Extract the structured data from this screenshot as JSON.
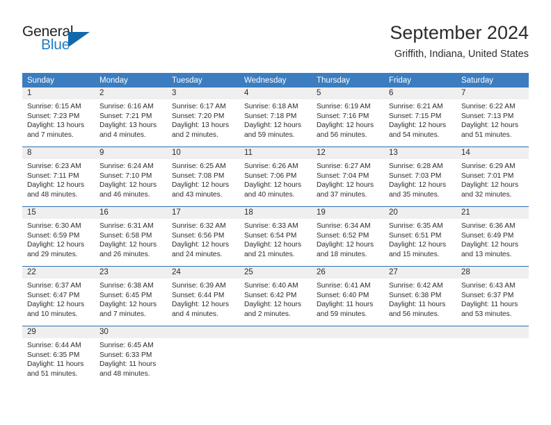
{
  "logo": {
    "word_top": "General",
    "word_bottom": "Blue",
    "triangle_color": "#1168ad",
    "blue_text_color": "#1f7fc4"
  },
  "header": {
    "title": "September 2024",
    "subtitle": "Griffith, Indiana, United States"
  },
  "theme": {
    "header_blue": "#3b7dbf",
    "separator_blue": "#2a6db5",
    "daynum_band": "#efefef",
    "text": "#2b2b2b"
  },
  "weekdays": [
    "Sunday",
    "Monday",
    "Tuesday",
    "Wednesday",
    "Thursday",
    "Friday",
    "Saturday"
  ],
  "weeks": [
    {
      "days": [
        {
          "num": "1",
          "sunrise": "Sunrise: 6:15 AM",
          "sunset": "Sunset: 7:23 PM",
          "daylight": "Daylight: 13 hours and 7 minutes."
        },
        {
          "num": "2",
          "sunrise": "Sunrise: 6:16 AM",
          "sunset": "Sunset: 7:21 PM",
          "daylight": "Daylight: 13 hours and 4 minutes."
        },
        {
          "num": "3",
          "sunrise": "Sunrise: 6:17 AM",
          "sunset": "Sunset: 7:20 PM",
          "daylight": "Daylight: 13 hours and 2 minutes."
        },
        {
          "num": "4",
          "sunrise": "Sunrise: 6:18 AM",
          "sunset": "Sunset: 7:18 PM",
          "daylight": "Daylight: 12 hours and 59 minutes."
        },
        {
          "num": "5",
          "sunrise": "Sunrise: 6:19 AM",
          "sunset": "Sunset: 7:16 PM",
          "daylight": "Daylight: 12 hours and 56 minutes."
        },
        {
          "num": "6",
          "sunrise": "Sunrise: 6:21 AM",
          "sunset": "Sunset: 7:15 PM",
          "daylight": "Daylight: 12 hours and 54 minutes."
        },
        {
          "num": "7",
          "sunrise": "Sunrise: 6:22 AM",
          "sunset": "Sunset: 7:13 PM",
          "daylight": "Daylight: 12 hours and 51 minutes."
        }
      ]
    },
    {
      "days": [
        {
          "num": "8",
          "sunrise": "Sunrise: 6:23 AM",
          "sunset": "Sunset: 7:11 PM",
          "daylight": "Daylight: 12 hours and 48 minutes."
        },
        {
          "num": "9",
          "sunrise": "Sunrise: 6:24 AM",
          "sunset": "Sunset: 7:10 PM",
          "daylight": "Daylight: 12 hours and 46 minutes."
        },
        {
          "num": "10",
          "sunrise": "Sunrise: 6:25 AM",
          "sunset": "Sunset: 7:08 PM",
          "daylight": "Daylight: 12 hours and 43 minutes."
        },
        {
          "num": "11",
          "sunrise": "Sunrise: 6:26 AM",
          "sunset": "Sunset: 7:06 PM",
          "daylight": "Daylight: 12 hours and 40 minutes."
        },
        {
          "num": "12",
          "sunrise": "Sunrise: 6:27 AM",
          "sunset": "Sunset: 7:04 PM",
          "daylight": "Daylight: 12 hours and 37 minutes."
        },
        {
          "num": "13",
          "sunrise": "Sunrise: 6:28 AM",
          "sunset": "Sunset: 7:03 PM",
          "daylight": "Daylight: 12 hours and 35 minutes."
        },
        {
          "num": "14",
          "sunrise": "Sunrise: 6:29 AM",
          "sunset": "Sunset: 7:01 PM",
          "daylight": "Daylight: 12 hours and 32 minutes."
        }
      ]
    },
    {
      "days": [
        {
          "num": "15",
          "sunrise": "Sunrise: 6:30 AM",
          "sunset": "Sunset: 6:59 PM",
          "daylight": "Daylight: 12 hours and 29 minutes."
        },
        {
          "num": "16",
          "sunrise": "Sunrise: 6:31 AM",
          "sunset": "Sunset: 6:58 PM",
          "daylight": "Daylight: 12 hours and 26 minutes."
        },
        {
          "num": "17",
          "sunrise": "Sunrise: 6:32 AM",
          "sunset": "Sunset: 6:56 PM",
          "daylight": "Daylight: 12 hours and 24 minutes."
        },
        {
          "num": "18",
          "sunrise": "Sunrise: 6:33 AM",
          "sunset": "Sunset: 6:54 PM",
          "daylight": "Daylight: 12 hours and 21 minutes."
        },
        {
          "num": "19",
          "sunrise": "Sunrise: 6:34 AM",
          "sunset": "Sunset: 6:52 PM",
          "daylight": "Daylight: 12 hours and 18 minutes."
        },
        {
          "num": "20",
          "sunrise": "Sunrise: 6:35 AM",
          "sunset": "Sunset: 6:51 PM",
          "daylight": "Daylight: 12 hours and 15 minutes."
        },
        {
          "num": "21",
          "sunrise": "Sunrise: 6:36 AM",
          "sunset": "Sunset: 6:49 PM",
          "daylight": "Daylight: 12 hours and 13 minutes."
        }
      ]
    },
    {
      "days": [
        {
          "num": "22",
          "sunrise": "Sunrise: 6:37 AM",
          "sunset": "Sunset: 6:47 PM",
          "daylight": "Daylight: 12 hours and 10 minutes."
        },
        {
          "num": "23",
          "sunrise": "Sunrise: 6:38 AM",
          "sunset": "Sunset: 6:45 PM",
          "daylight": "Daylight: 12 hours and 7 minutes."
        },
        {
          "num": "24",
          "sunrise": "Sunrise: 6:39 AM",
          "sunset": "Sunset: 6:44 PM",
          "daylight": "Daylight: 12 hours and 4 minutes."
        },
        {
          "num": "25",
          "sunrise": "Sunrise: 6:40 AM",
          "sunset": "Sunset: 6:42 PM",
          "daylight": "Daylight: 12 hours and 2 minutes."
        },
        {
          "num": "26",
          "sunrise": "Sunrise: 6:41 AM",
          "sunset": "Sunset: 6:40 PM",
          "daylight": "Daylight: 11 hours and 59 minutes."
        },
        {
          "num": "27",
          "sunrise": "Sunrise: 6:42 AM",
          "sunset": "Sunset: 6:38 PM",
          "daylight": "Daylight: 11 hours and 56 minutes."
        },
        {
          "num": "28",
          "sunrise": "Sunrise: 6:43 AM",
          "sunset": "Sunset: 6:37 PM",
          "daylight": "Daylight: 11 hours and 53 minutes."
        }
      ]
    },
    {
      "days": [
        {
          "num": "29",
          "sunrise": "Sunrise: 6:44 AM",
          "sunset": "Sunset: 6:35 PM",
          "daylight": "Daylight: 11 hours and 51 minutes."
        },
        {
          "num": "30",
          "sunrise": "Sunrise: 6:45 AM",
          "sunset": "Sunset: 6:33 PM",
          "daylight": "Daylight: 11 hours and 48 minutes."
        },
        {
          "num": "",
          "sunrise": "",
          "sunset": "",
          "daylight": ""
        },
        {
          "num": "",
          "sunrise": "",
          "sunset": "",
          "daylight": ""
        },
        {
          "num": "",
          "sunrise": "",
          "sunset": "",
          "daylight": ""
        },
        {
          "num": "",
          "sunrise": "",
          "sunset": "",
          "daylight": ""
        },
        {
          "num": "",
          "sunrise": "",
          "sunset": "",
          "daylight": ""
        }
      ]
    }
  ]
}
